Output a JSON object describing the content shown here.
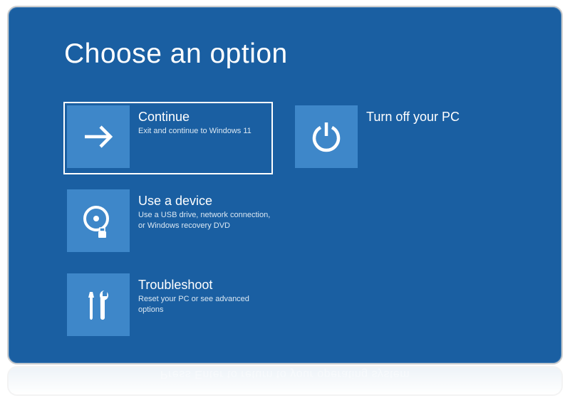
{
  "title": "Choose an option",
  "options": {
    "continue": {
      "title": "Continue",
      "desc": "Exit and continue to Windows 11"
    },
    "turnoff": {
      "title": "Turn off your PC",
      "desc": ""
    },
    "device": {
      "title": "Use a device",
      "desc": "Use a USB drive, network connection, or Windows recovery DVD"
    },
    "troubleshoot": {
      "title": "Troubleshoot",
      "desc": "Reset your PC or see advanced options"
    }
  },
  "reflection": "Press Enter to return to your operating system"
}
